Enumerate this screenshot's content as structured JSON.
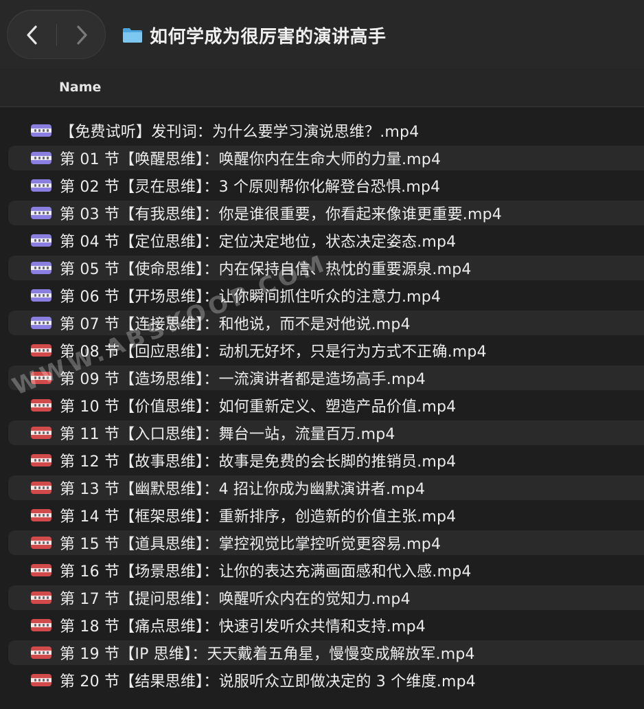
{
  "window": {
    "title": "如何学成为很厉害的演讲高手",
    "folder_icon": "folder-icon",
    "back_icon": "chevron-left-icon",
    "forward_icon": "chevron-right-icon"
  },
  "columns": {
    "name": "Name"
  },
  "colors": {
    "background": "#1e1e1e",
    "row_alt": "#2a2a2a",
    "icon_purple": "#8a7fe0",
    "icon_red": "#d24a4a",
    "folder_blue": "#5cb4e8"
  },
  "files": [
    {
      "name": "【免费试听】发刊词：为什么要学习演说思维？.mp4",
      "icon": "video-file-icon",
      "icon_color": "#8a7fe0"
    },
    {
      "name": "第 01 节【唤醒思维】：唤醒你内在生命大师的力量.mp4",
      "icon": "video-file-icon",
      "icon_color": "#8a7fe0"
    },
    {
      "name": "第 02 节【灵在思维】：3 个原则帮你化解登台恐惧.mp4",
      "icon": "video-file-icon",
      "icon_color": "#8a7fe0"
    },
    {
      "name": "第 03 节【有我思维】：你是谁很重要，你看起来像谁更重要.mp4",
      "icon": "video-file-icon",
      "icon_color": "#8a7fe0"
    },
    {
      "name": "第 04 节【定位思维】：定位决定地位，状态决定姿态.mp4",
      "icon": "video-file-icon",
      "icon_color": "#8a7fe0"
    },
    {
      "name": "第 05 节【使命思维】：内在保持自信、热忱的重要源泉.mp4",
      "icon": "video-file-icon",
      "icon_color": "#8a7fe0"
    },
    {
      "name": "第 06 节【开场思维】：让你瞬间抓住听众的注意力.mp4",
      "icon": "video-file-icon",
      "icon_color": "#8a7fe0"
    },
    {
      "name": "第 07 节【连接思维】：和他说，而不是对他说.mp4",
      "icon": "video-file-icon",
      "icon_color": "#8a7fe0"
    },
    {
      "name": "第 08 节【回应思维】：动机无好坏，只是行为方式不正确.mp4",
      "icon": "video-file-icon",
      "icon_color": "#d24a4a"
    },
    {
      "name": "第 09 节【造场思维】：一流演讲者都是造场高手.mp4",
      "icon": "video-file-icon",
      "icon_color": "#d24a4a"
    },
    {
      "name": "第 10 节【价值思维】：如何重新定义、塑造产品价值.mp4",
      "icon": "video-file-icon",
      "icon_color": "#d24a4a"
    },
    {
      "name": "第 11 节【入口思维】：舞台一站，流量百万.mp4",
      "icon": "video-file-icon",
      "icon_color": "#d24a4a"
    },
    {
      "name": "第 12 节【故事思维】：故事是免费的会长脚的推销员.mp4",
      "icon": "video-file-icon",
      "icon_color": "#d24a4a"
    },
    {
      "name": "第 13 节【幽默思维】：4 招让你成为幽默演讲者.mp4",
      "icon": "video-file-icon",
      "icon_color": "#d24a4a"
    },
    {
      "name": "第 14 节【框架思维】：重新排序，创造新的价值主张.mp4",
      "icon": "video-file-icon",
      "icon_color": "#d24a4a"
    },
    {
      "name": "第 15 节【道具思维】：掌控视觉比掌控听觉更容易.mp4",
      "icon": "video-file-icon",
      "icon_color": "#d24a4a"
    },
    {
      "name": "第 16 节【场景思维】：让你的表达充满画面感和代入感.mp4",
      "icon": "video-file-icon",
      "icon_color": "#d24a4a"
    },
    {
      "name": "第 17 节【提问思维】：唤醒听众内在的觉知力.mp4",
      "icon": "video-file-icon",
      "icon_color": "#d24a4a"
    },
    {
      "name": "第 18 节【痛点思维】：快速引发听众共情和支持.mp4",
      "icon": "video-file-icon",
      "icon_color": "#d24a4a"
    },
    {
      "name": "第 19 节【IP 思维】：天天戴着五角星，慢慢变成解放军.mp4",
      "icon": "video-file-icon",
      "icon_color": "#d24a4a"
    },
    {
      "name": "第 20 节【结果思维】：说服听众立即做决定的 3 个维度.mp4",
      "icon": "video-file-icon",
      "icon_color": "#d24a4a"
    }
  ],
  "watermark": {
    "text": "WWW.ABSKOOP.COM",
    "top_text": "W W"
  }
}
